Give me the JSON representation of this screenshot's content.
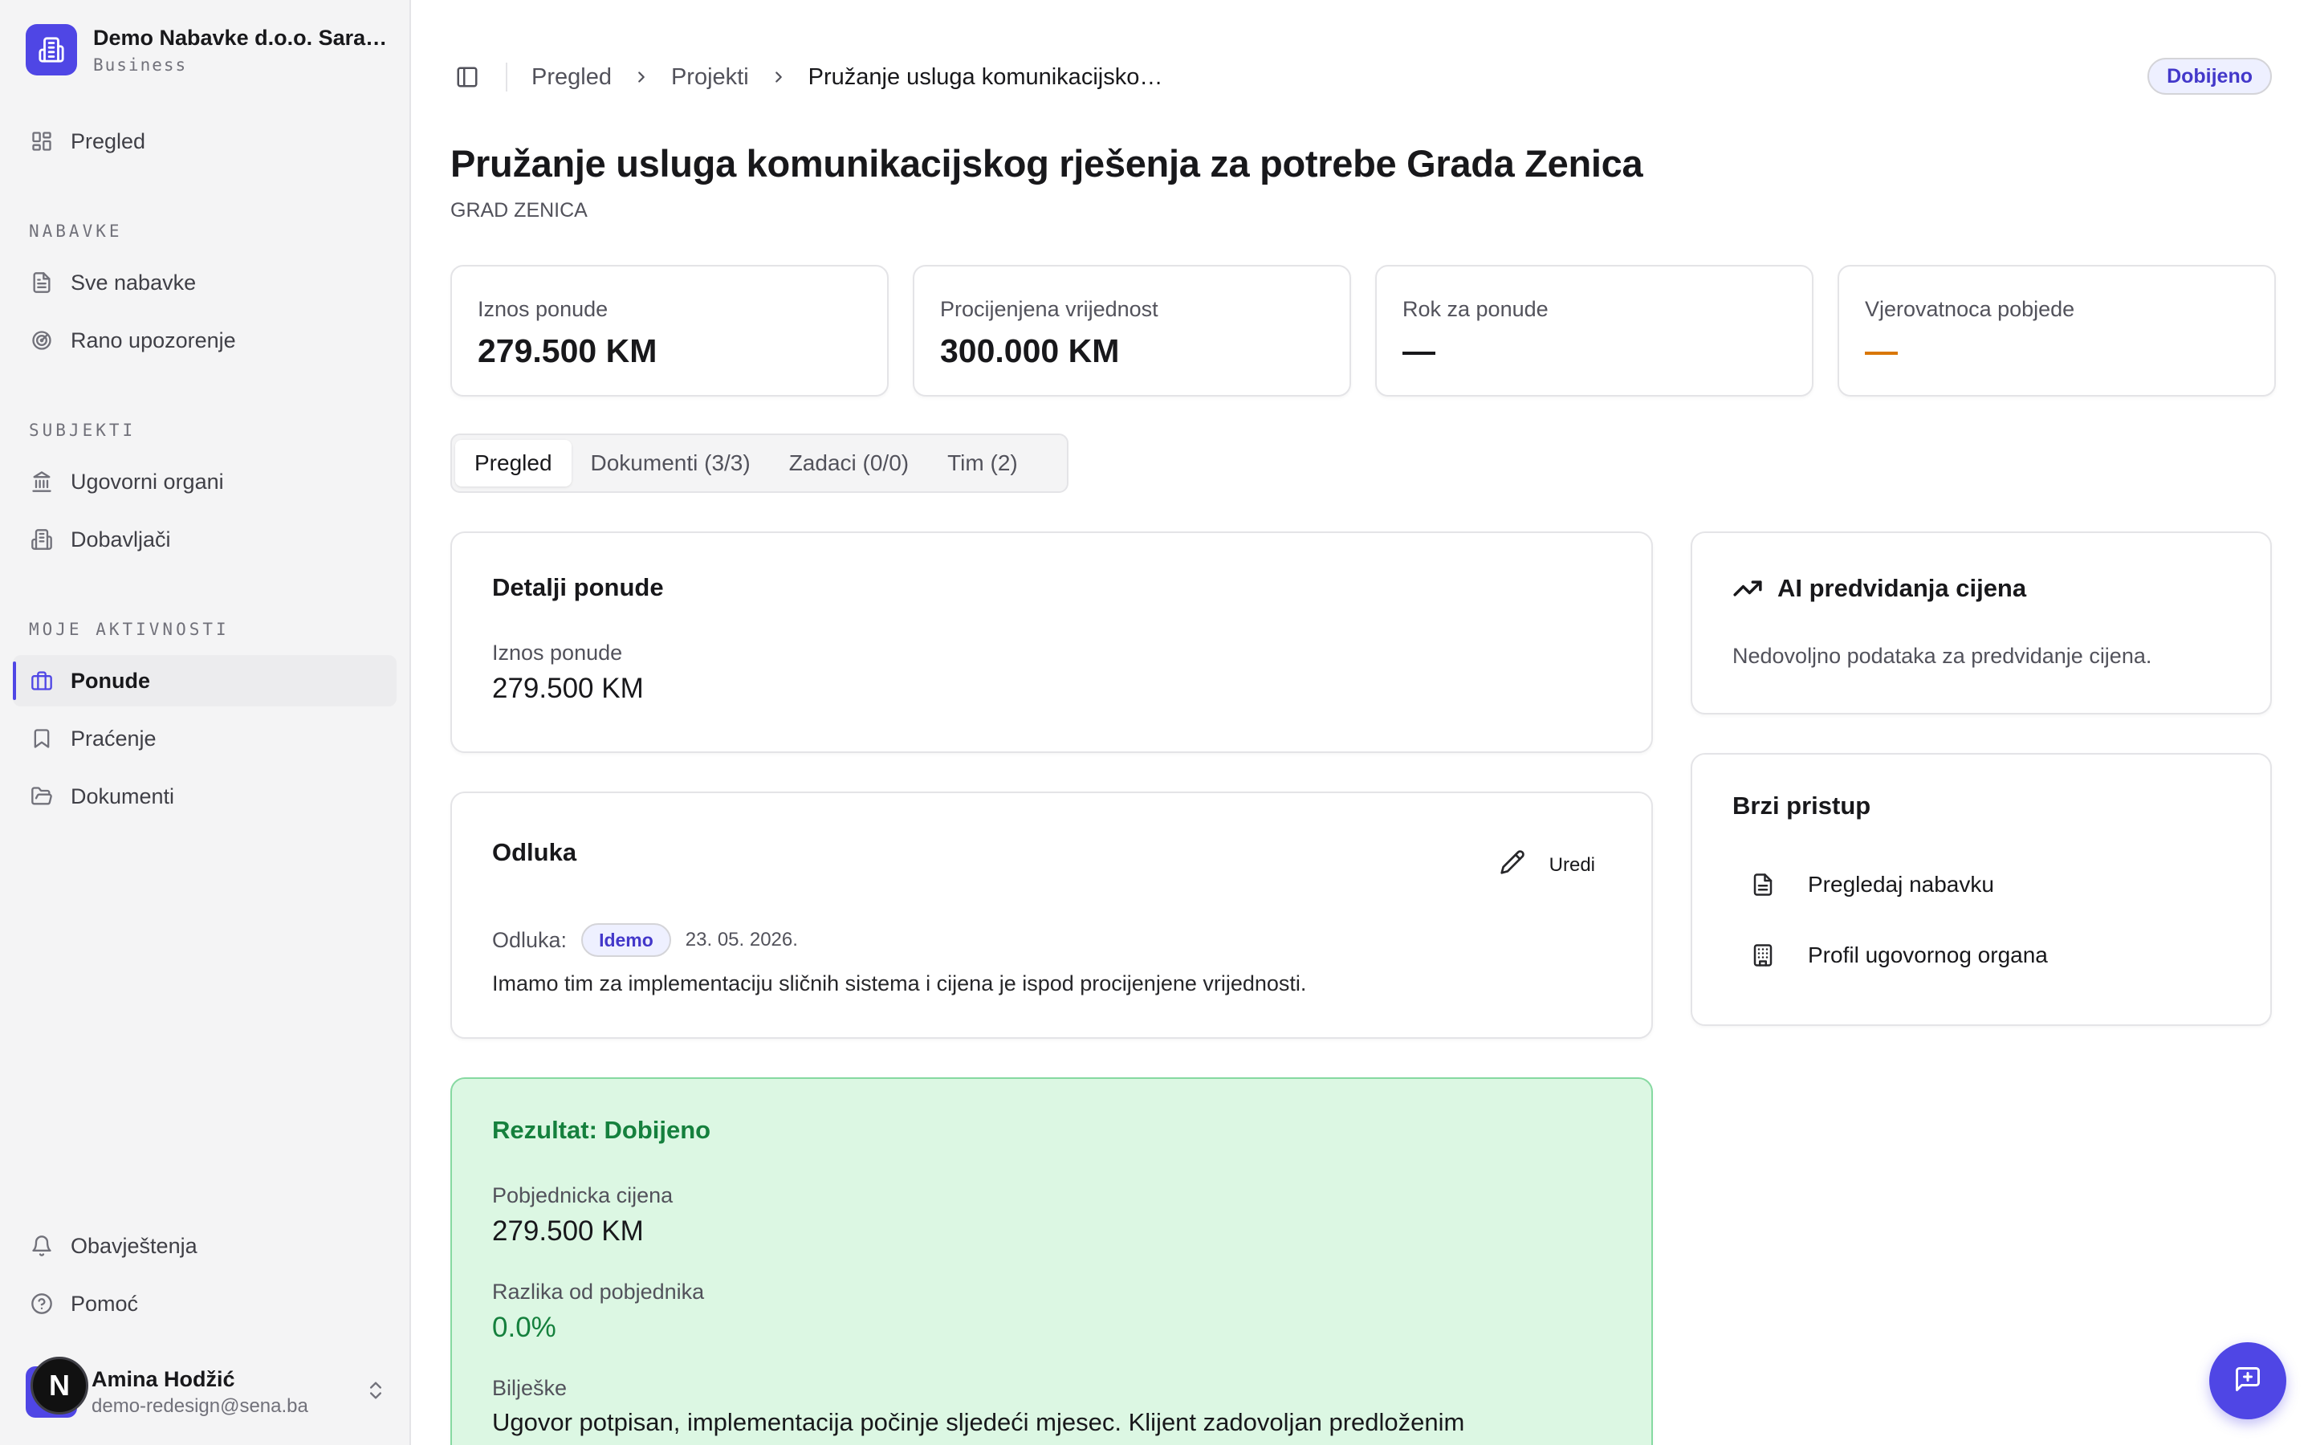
{
  "org": {
    "name": "Demo Nabavke d.o.o. Sarajevo",
    "plan": "Business"
  },
  "sidebar": {
    "overview": "Pregled",
    "sections": {
      "nabavke": "NABAVKE",
      "subjekti": "SUBJEKTI",
      "aktivnosti": "MOJE AKTIVNOSTI"
    },
    "items": {
      "sve_nabavke": "Sve nabavke",
      "rano_upozorenje": "Rano upozorenje",
      "ugovorni_organi": "Ugovorni organi",
      "dobavljaci": "Dobavljači",
      "ponude": "Ponude",
      "pracenje": "Praćenje",
      "dokumenti": "Dokumenti"
    },
    "footer": {
      "obavjestenja": "Obavještenja",
      "pomoc": "Pomoć"
    }
  },
  "user": {
    "name": "Amina Hodžić",
    "email": "demo-redesign@sena.ba",
    "badge": "N"
  },
  "breadcrumb": {
    "home": "Pregled",
    "projects": "Projekti",
    "current": "Pružanje usluga komunikacijsko…"
  },
  "status": "Dobijeno",
  "page": {
    "title": "Pružanje usluga komunikacijskog rješenja za potrebe Grada Zenica",
    "subtitle": "GRAD ZENICA"
  },
  "stats": [
    {
      "label": "Iznos ponude",
      "value": "279.500 KM"
    },
    {
      "label": "Procijenjena vrijednost",
      "value": "300.000 KM"
    },
    {
      "label": "Rok za ponude",
      "value": "—",
      "color": "#18181b"
    },
    {
      "label": "Vjerovatnoca pobjede",
      "value": "—",
      "color": "#d97706"
    }
  ],
  "tabs": [
    "Pregled",
    "Dokumenti (3/3)",
    "Zadaci (0/0)",
    "Tim (2)"
  ],
  "details": {
    "title": "Detalji ponude",
    "amount_label": "Iznos ponude",
    "amount_value": "279.500 KM"
  },
  "decision": {
    "title": "Odluka",
    "edit": "Uredi",
    "label": "Odluka:",
    "badge": "Idemo",
    "date": "23. 05. 2026.",
    "text": "Imamo tim za implementaciju sličnih sistema i cijena je ispod procijenjene vrijednosti."
  },
  "result": {
    "title": "Rezultat: Dobijeno",
    "winning_label": "Pobjednicka cijena",
    "winning_value": "279.500 KM",
    "diff_label": "Razlika od pobjednika",
    "diff_value": "0.0%",
    "notes_label": "Bilješke",
    "notes_value": "Ugovor potpisan, implementacija počinje sljedeći mjesec. Klijent zadovoljan predloženim"
  },
  "ai": {
    "title": "AI predvidanja cijena",
    "text": "Nedovoljno podataka za predvidanje cijena."
  },
  "quick": {
    "title": "Brzi pristup",
    "items": [
      "Pregledaj nabavku",
      "Profil ugovornog organa"
    ]
  },
  "colors": {
    "accent": "#4f46e5",
    "success": "#15803d",
    "warning": "#d97706"
  }
}
